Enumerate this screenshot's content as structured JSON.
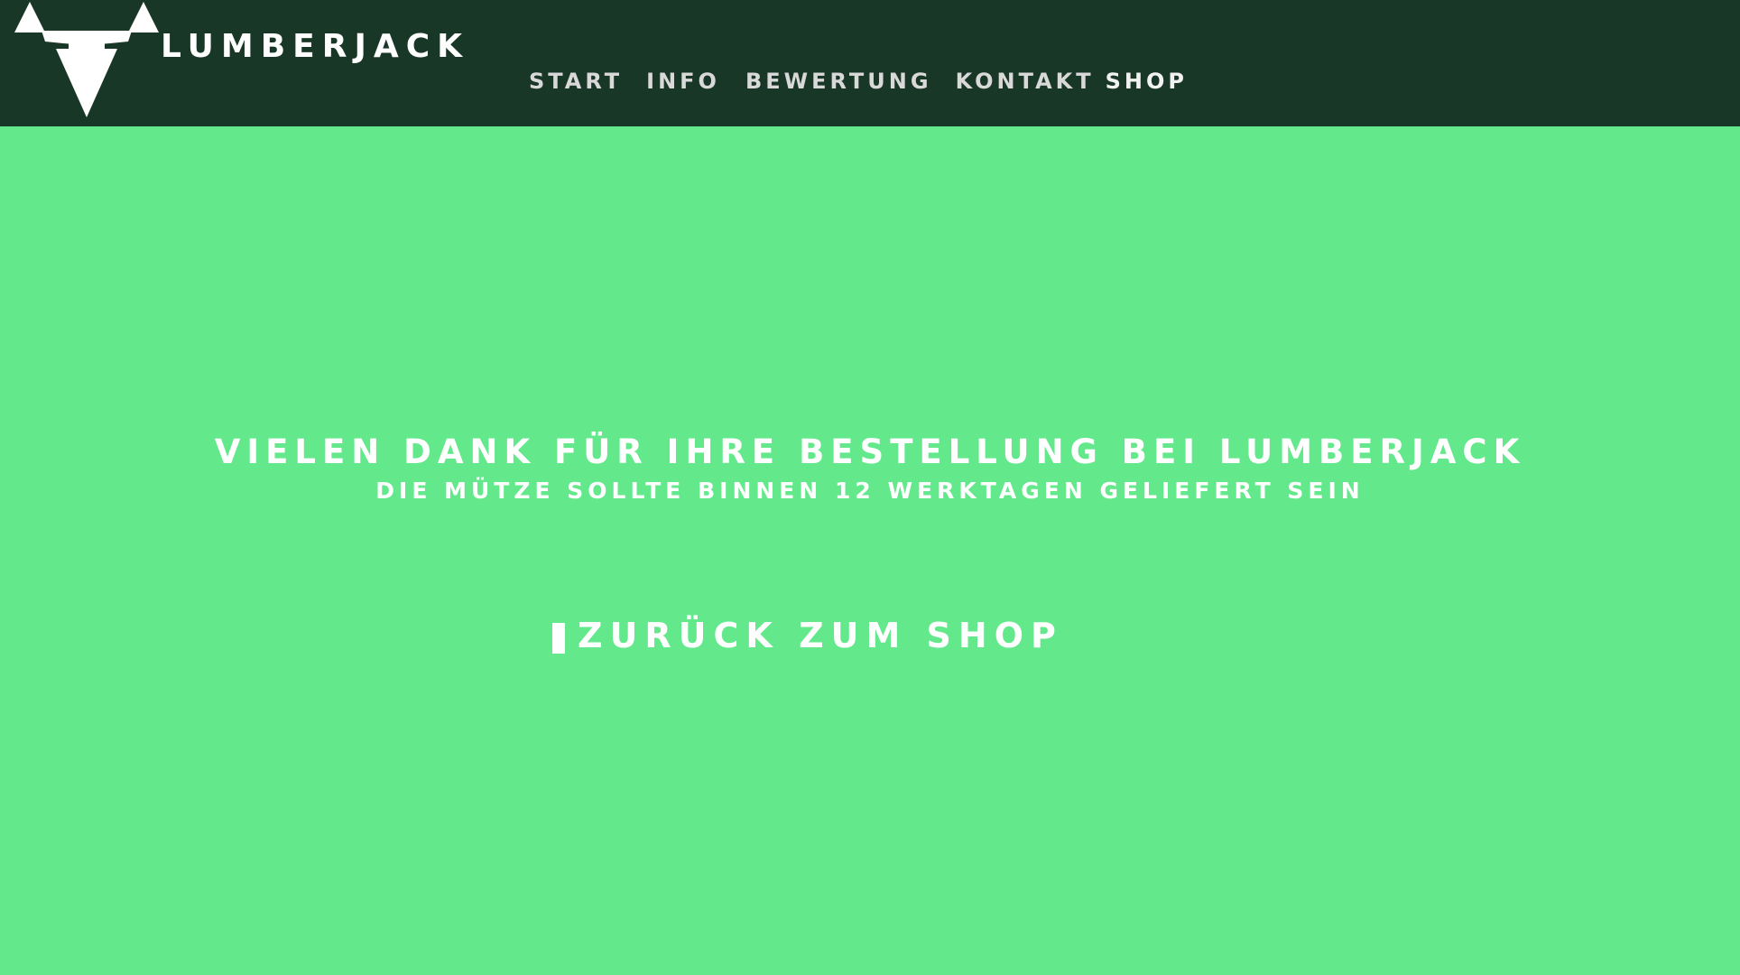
{
  "brand": {
    "name": "LUMBERJACK",
    "logo_icon": "bull-head-icon"
  },
  "nav": {
    "items": [
      {
        "label": "START"
      },
      {
        "label": "INFO"
      },
      {
        "label": "BEWERTUNG"
      },
      {
        "label": "KONTAKT"
      },
      {
        "label": "SHOP"
      }
    ]
  },
  "main": {
    "title": "VIELEN DANK FÜR IHRE BESTELLUNG BEI LUMBERJACK",
    "subtitle": "DIE MÜTZE SOLLTE BINNEN 12 WERKTAGEN GELIEFERT SEIN",
    "back_link_label": "ZURÜCK ZUM SHOP"
  },
  "colors": {
    "header_bg": "#193726",
    "page_bg": "#63e98b",
    "text": "#ffffff",
    "nav_text": "#d9d9d9"
  }
}
